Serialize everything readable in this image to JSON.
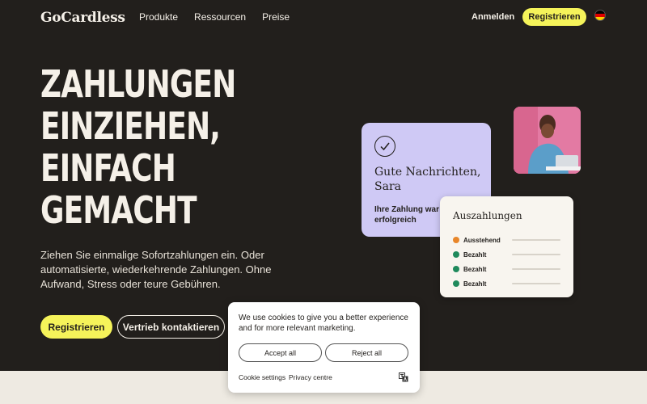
{
  "nav": {
    "logo": "GoCardless",
    "links": [
      "Produkte",
      "Ressourcen",
      "Preise"
    ],
    "login": "Anmelden",
    "register": "Registrieren",
    "language_flag": "germany-flag-icon"
  },
  "hero": {
    "headline": [
      "ZAHLUNGEN",
      "EINZIEHEN,",
      "EINFACH",
      "GEMACHT"
    ],
    "subtext": "Ziehen Sie einmalige Sofortzahlungen ein. Oder automatisierte, wiederkehrende Zahlungen. Ohne Aufwand, Stress oder teure Gebühren.",
    "primary_button": "Registrieren",
    "secondary_button": "Vertrieb kontaktieren"
  },
  "success_card": {
    "icon": "checkmark-icon",
    "title": "Gute Nachrichten, Sara",
    "message": "Ihre Zahlung war erfolgreich",
    "color": "#cfc9f5"
  },
  "payouts_card": {
    "title": "Auszahlungen",
    "rows": [
      {
        "status": "Ausstehend",
        "color": "#e8862a"
      },
      {
        "status": "Bezahlt",
        "color": "#1f8a5c"
      },
      {
        "status": "Bezahlt",
        "color": "#1f8a5c"
      },
      {
        "status": "Bezahlt",
        "color": "#1f8a5c"
      }
    ]
  },
  "cookie": {
    "text": "We use cookies to give you a better experience and for more relevant marketing.",
    "accept": "Accept all",
    "reject": "Reject all",
    "settings": "Cookie settings",
    "privacy": "Privacy centre",
    "icon": "translate-icon"
  },
  "colors": {
    "background": "#221f1c",
    "accent": "#f5f35a",
    "text": "#f5f0e8"
  }
}
